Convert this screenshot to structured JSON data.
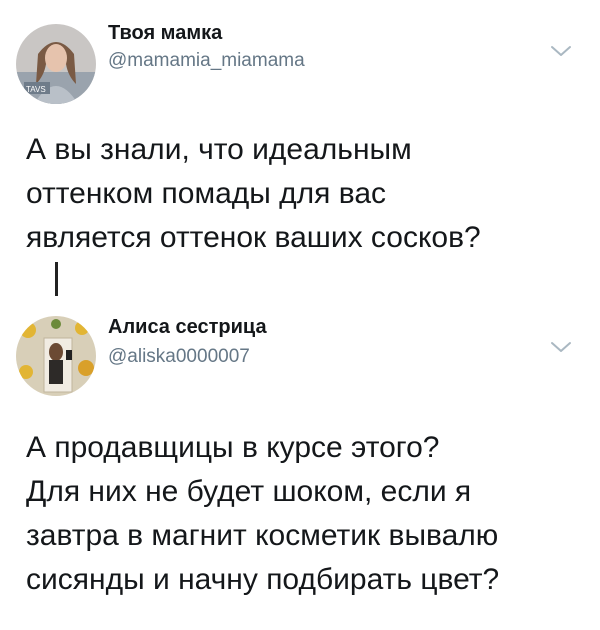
{
  "tweets": [
    {
      "author_name": "Твоя мамка",
      "author_handle": "@mamamia_miamama",
      "text": "А вы знали, что идеальным\nоттенком помады для вас\nявляется оттенок ваших сосков?"
    },
    {
      "author_name": "Алиса сестрица",
      "author_handle": "@aliska0000007",
      "text": "А продавщицы в курсе этого?\nДля них не будет шоком, если я\nзавтра в магнит косметик вывалю\nсисянды и начну подбирать цвет?"
    }
  ],
  "icons": {
    "more": "chevron-down-icon"
  },
  "colors": {
    "text": "#14171a",
    "handle": "#657786",
    "chevron": "#aab8c2",
    "thread_line": "#222222"
  }
}
